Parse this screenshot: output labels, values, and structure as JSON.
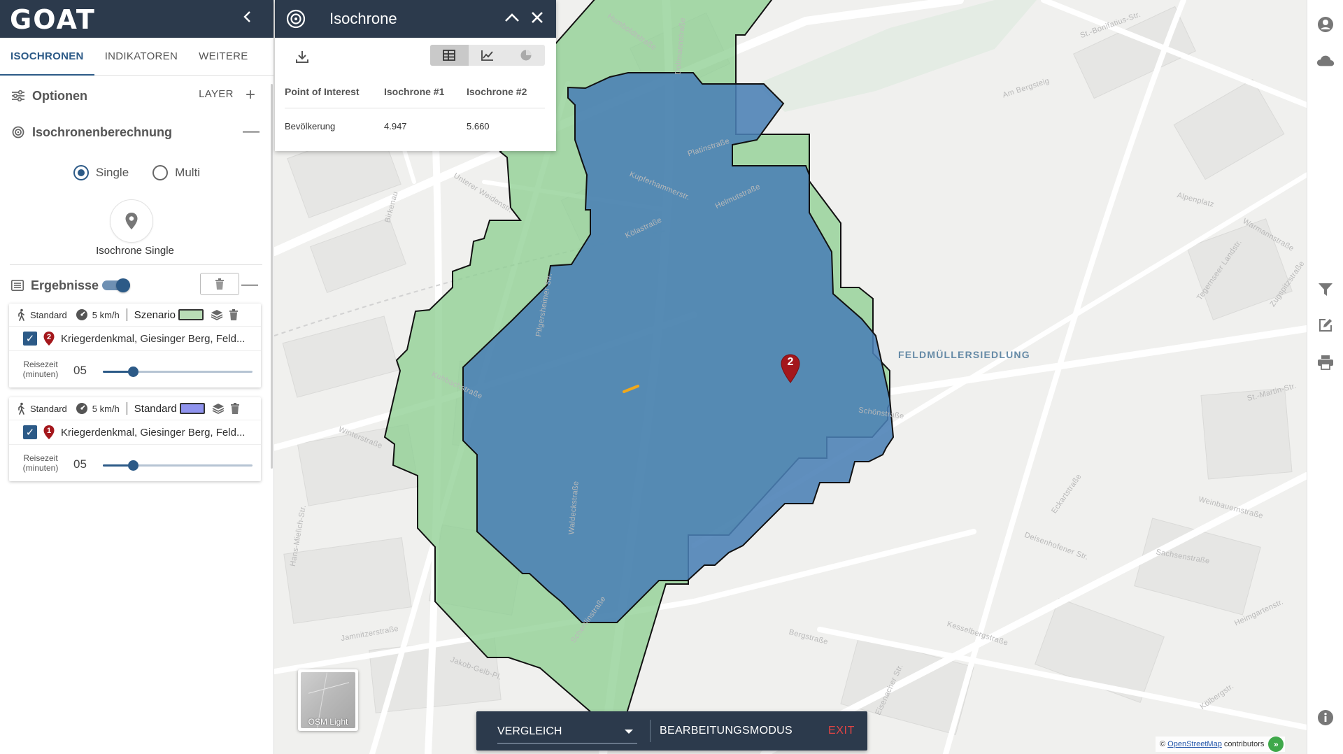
{
  "app": {
    "logo": "GOAT"
  },
  "tabs": [
    {
      "label": "ISOCHRONEN",
      "active": true
    },
    {
      "label": "INDIKATOREN",
      "active": false
    },
    {
      "label": "WEITERE LAYER",
      "active": false
    }
  ],
  "sections": {
    "options": {
      "label": "Optionen",
      "toggle": "+"
    },
    "calc": {
      "label": "Isochronenberechnung",
      "toggle": "—"
    }
  },
  "mode": {
    "options": [
      {
        "label": "Single",
        "checked": true
      },
      {
        "label": "Multi",
        "checked": false
      }
    ],
    "poi_button_label": "Isochrone Single"
  },
  "results": {
    "label": "Ergebnisse",
    "toggle_on": true,
    "collapse": "—",
    "cards": [
      {
        "mode": "Standard",
        "speed": "5 km/h",
        "scenario": "Szenario",
        "color": "#b9dcb6",
        "checked": true,
        "number": "2",
        "poi": "Kriegerdenkmal, Giesinger Berg, Feld...",
        "time_label": "Reisezeit (minuten)",
        "time_line1": "Reisezeit",
        "time_line2": "(minuten)",
        "minutes": "05",
        "slider_value": 0.2
      },
      {
        "mode": "Standard",
        "speed": "5 km/h",
        "scenario": "Standard",
        "color": "#8f93ee",
        "checked": true,
        "number": "1",
        "poi": "Kriegerdenkmal, Giesinger Berg, Feld...",
        "time_label": "Reisezeit (minuten)",
        "time_line1": "Reisezeit",
        "time_line2": "(minuten)",
        "minutes": "05",
        "slider_value": 0.2
      }
    ]
  },
  "iso_panel": {
    "title": "Isochrone",
    "view": "table",
    "table": {
      "headers": [
        "Point of Interest",
        "Isochrone #1",
        "Isochrone #2"
      ],
      "rows": [
        [
          "Bevölkerung",
          "4.947",
          "5.660"
        ]
      ]
    }
  },
  "map": {
    "marker_number": "2",
    "district": "FELDMÜLLERSIEDLUNG",
    "iso_colors": {
      "scenario": "#8fcf93",
      "standard": "#4a7fb5"
    },
    "streets": [
      "Humboldtstraße",
      "Dollmannstraße",
      "Platinstraße",
      "Kupferhammerstr.",
      "Helmutstraße",
      "Kölastraße",
      "Unterer Weidenstr.",
      "Birkenau",
      "Pilgersheimer Str.",
      "Kuhbachstraße",
      "Winterstraße",
      "Hans-Mielich-Str.",
      "Jamnitzerstraße",
      "Jakob-Gelb-Pl.",
      "Waldeckstraße",
      "Schertlinstraße",
      "St.-Bonifatius-Str.",
      "Am Bergsteig",
      "Tegernseer Landstr.",
      "Alpenplatz",
      "Warmannstraße",
      "Zugspitzstraße",
      "St.-Martin-Str.",
      "Weinbauernstraße",
      "Deisenhofener Str.",
      "Kesselbergstraße",
      "Schönstraße",
      "Bergstraße",
      "Eisenacher Str.",
      "Eckartstraße",
      "Sachsenstraße",
      "Heimgartenstr.",
      "Kölbergstr."
    ]
  },
  "bottom_bar": {
    "compare": "VERGLEICH",
    "edit": "BEARBEITUNGSMODUS",
    "exit": "EXIT"
  },
  "basemap": {
    "label": "OSM Light"
  },
  "attribution": {
    "prefix": "©",
    "link": "OpenStreetMap",
    "suffix": "contributors",
    "button": "»"
  }
}
